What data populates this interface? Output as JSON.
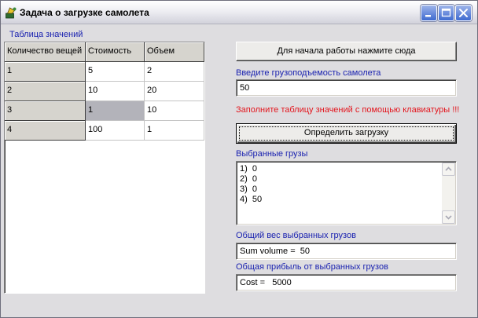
{
  "window": {
    "title": "Задача о загрузке самолета",
    "icons": {
      "app": "application-icon",
      "minimize": "minimize-icon",
      "maximize": "maximize-icon",
      "close": "close-icon"
    }
  },
  "table": {
    "caption": "Таблица значений",
    "columns": [
      "Количество вещей",
      "Стоимость",
      "Объем"
    ],
    "rows": [
      [
        "1",
        "5",
        "2"
      ],
      [
        "2",
        "10",
        "20"
      ],
      [
        "3",
        "1",
        "10"
      ],
      [
        "4",
        "100",
        "1"
      ]
    ],
    "selected_cell": {
      "row_index": 2,
      "column_index": 1
    }
  },
  "controls": {
    "start_button_label": "Для начала работы нажмите сюда",
    "capacity_label": "Введите грузоподъемость самолета",
    "capacity_value": "50",
    "warning_text": "Заполните таблицу значений с помощью клавиатуры !!!",
    "compute_button_label": "Определить загрузку",
    "selected_label": "Выбранные грузы",
    "selected_items": [
      "1)  0",
      "2)  0",
      "3)  0",
      "4)  50"
    ],
    "total_weight_label": "Общий вес выбранных грузов",
    "total_weight_value": "Sum volume =  50",
    "total_profit_label": "Общая прибыль от выбранных грузов",
    "total_profit_value": "Cost =   5000",
    "scroll_icons": {
      "up": "scroll-up-icon",
      "down": "scroll-down-icon"
    }
  },
  "colors": {
    "label_text": "#1A22B0",
    "warning_text": "#E3161E",
    "window_background": "#DEDDE0",
    "selected_cell": "#B3B3BA",
    "title_button": "#3F6AD0"
  }
}
